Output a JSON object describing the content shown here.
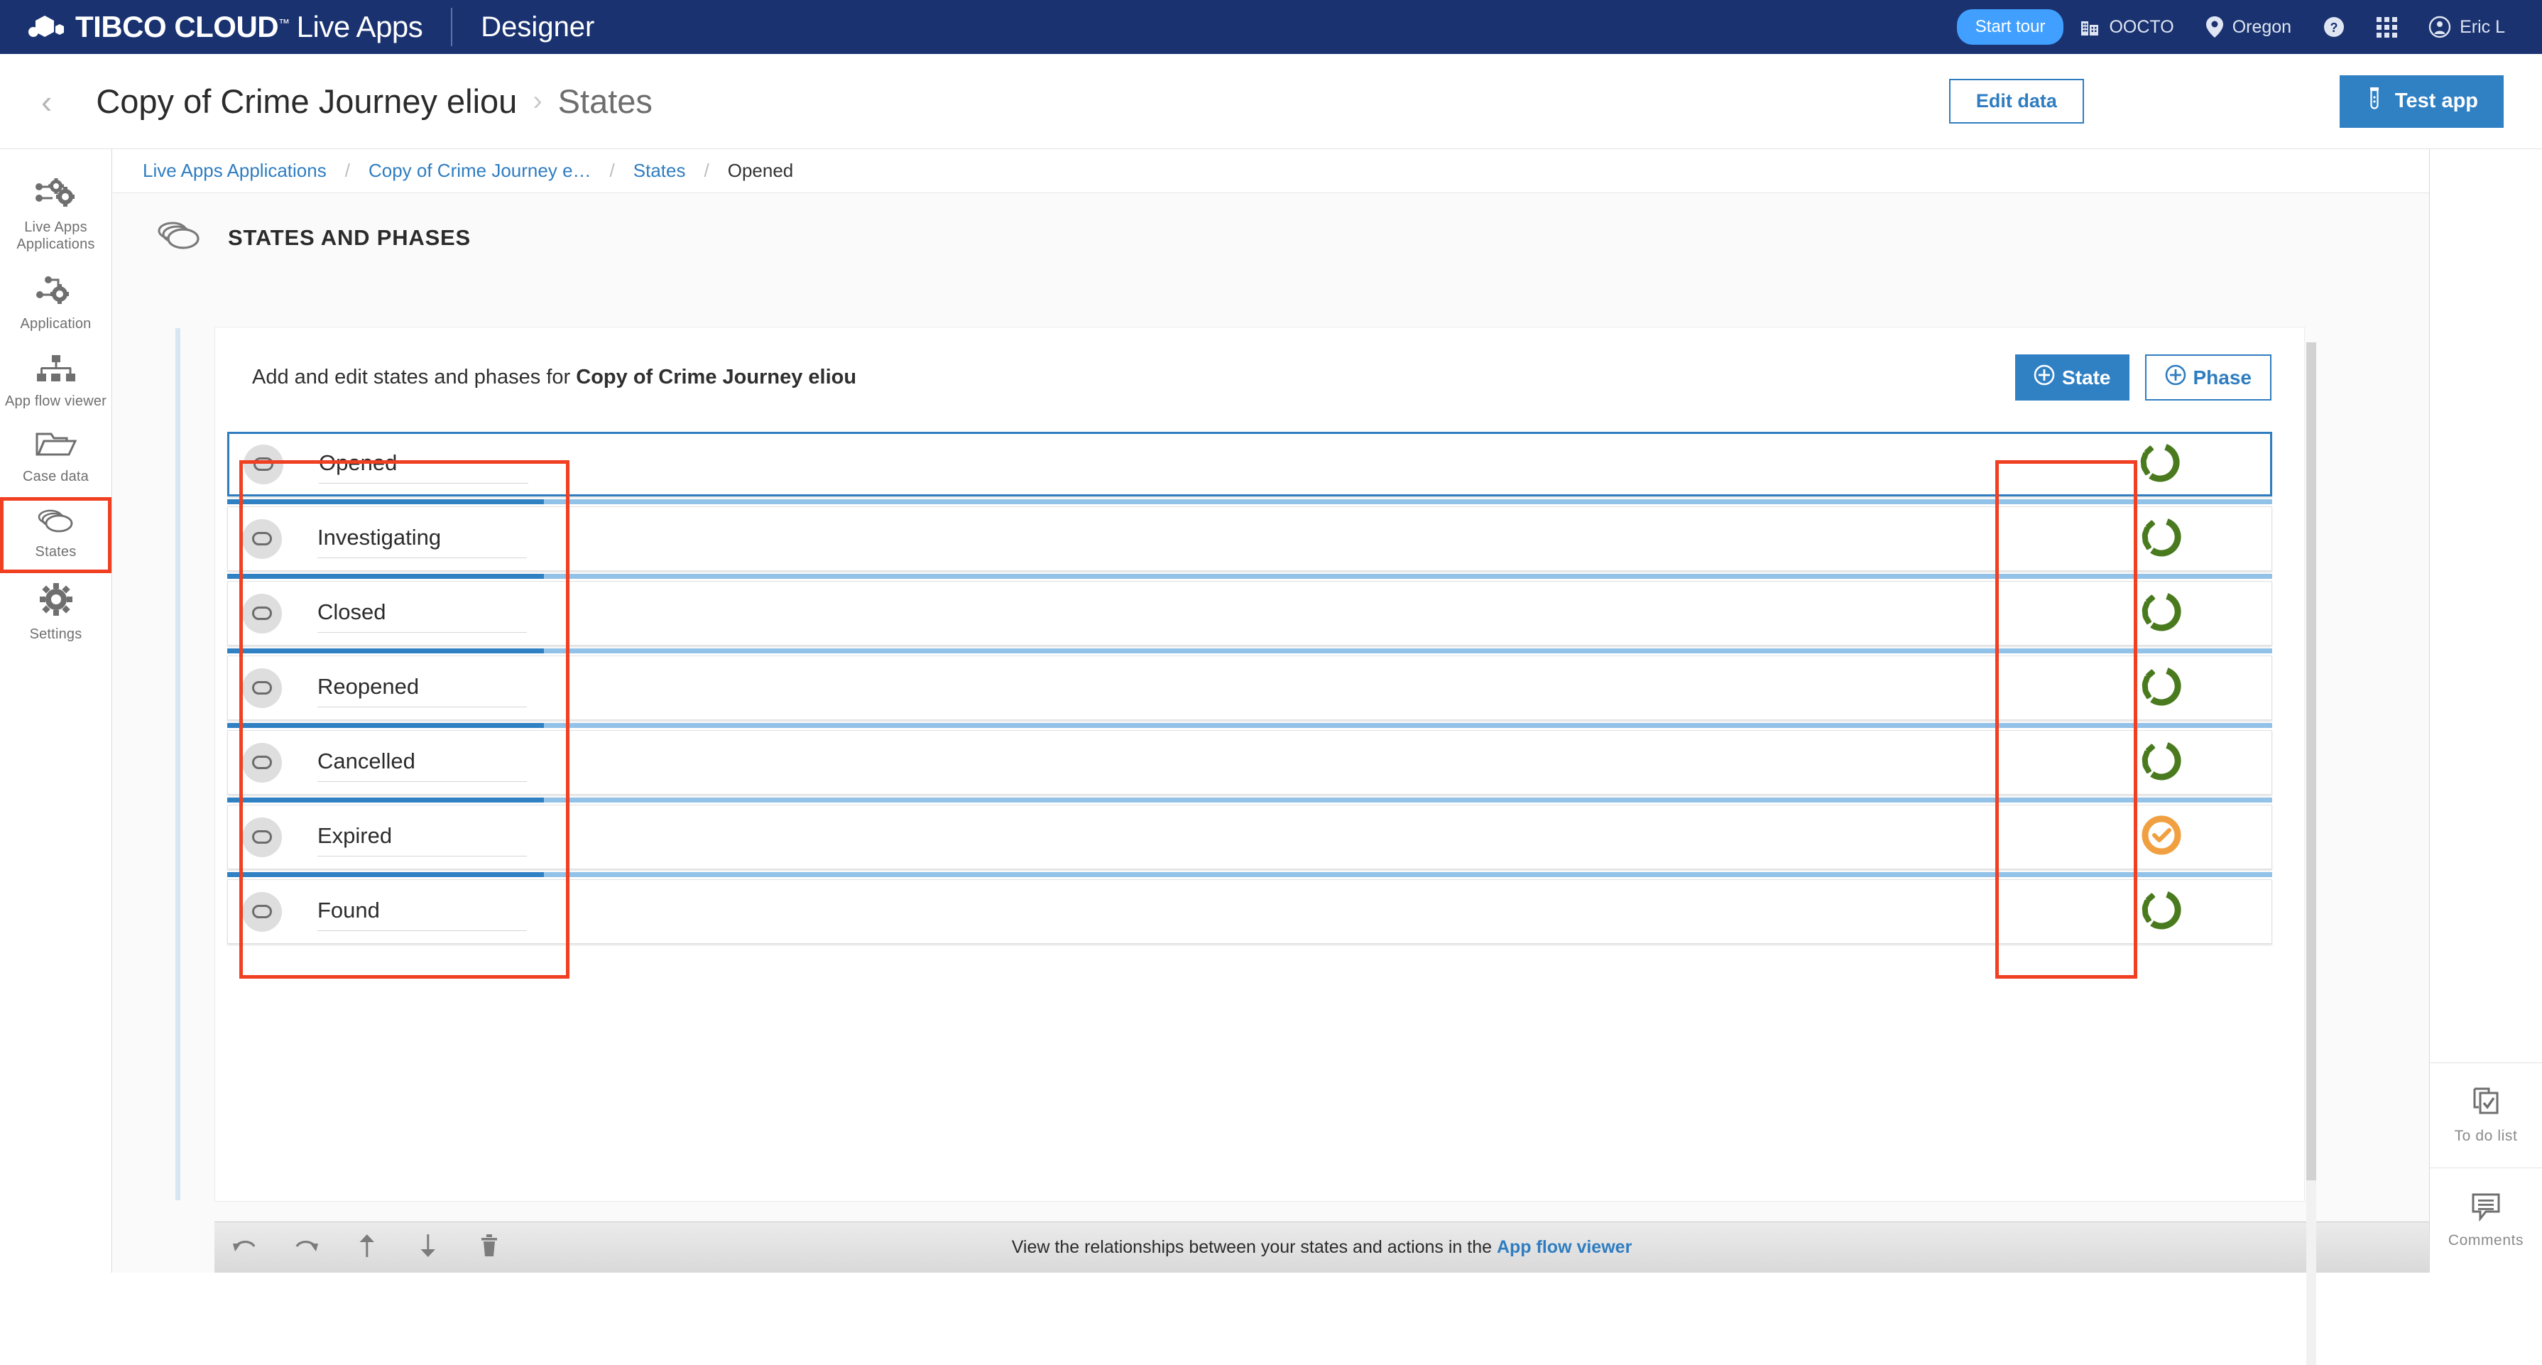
{
  "topnav": {
    "brand_bold": "TIBCO CLOUD",
    "brand_light": "Live Apps",
    "tm": "™",
    "product": "Designer",
    "start_tour": "Start tour",
    "org": "OOCTO",
    "region": "Oregon",
    "user": "Eric L",
    "icons": {
      "building": "building-icon",
      "location": "location-pin-icon",
      "help": "help-circle-icon",
      "apps": "apps-grid-icon",
      "avatar": "user-avatar-icon"
    }
  },
  "titlebar": {
    "back": "‹",
    "app_name": "Copy of Crime Journey eliou",
    "separator": "›",
    "section": "States",
    "edit_data": "Edit data",
    "test_app": "Test app"
  },
  "sidebar": {
    "items": [
      {
        "label": "Live Apps Applications",
        "icon": "live-apps-applications-icon",
        "active": false
      },
      {
        "label": "Application",
        "icon": "application-icon",
        "active": false
      },
      {
        "label": "App flow viewer",
        "icon": "app-flow-viewer-icon",
        "active": false
      },
      {
        "label": "Case data",
        "icon": "case-data-folder-icon",
        "active": false
      },
      {
        "label": "States",
        "icon": "states-stack-icon",
        "active": true
      },
      {
        "label": "Settings",
        "icon": "settings-gear-icon",
        "active": false
      }
    ]
  },
  "breadcrumb": {
    "items": [
      "Live Apps Applications",
      "Copy of Crime Journey e…",
      "States"
    ],
    "current": "Opened",
    "separator": "/"
  },
  "section": {
    "title": "STATES AND PHASES",
    "icon": "states-stack-icon"
  },
  "panel": {
    "desc_prefix": "Add and edit states and phases for ",
    "desc_app": "Copy of Crime Journey eliou",
    "add_state": "State",
    "add_phase": "Phase",
    "plus_icon": "plus-circle-icon"
  },
  "states": [
    {
      "name": "Opened",
      "selected": true,
      "status_icon": "in-progress-icon",
      "status": "in-progress"
    },
    {
      "name": "Investigating",
      "selected": false,
      "status_icon": "in-progress-icon",
      "status": "in-progress"
    },
    {
      "name": "Closed",
      "selected": false,
      "status_icon": "in-progress-icon",
      "status": "in-progress"
    },
    {
      "name": "Reopened",
      "selected": false,
      "status_icon": "in-progress-icon",
      "status": "in-progress"
    },
    {
      "name": "Cancelled",
      "selected": false,
      "status_icon": "in-progress-icon",
      "status": "in-progress"
    },
    {
      "name": "Expired",
      "selected": false,
      "status_icon": "terminal-check-icon",
      "status": "terminal"
    },
    {
      "name": "Found",
      "selected": false,
      "status_icon": "in-progress-icon",
      "status": "in-progress"
    }
  ],
  "bottombar": {
    "tools": [
      {
        "name": "undo-icon",
        "label": "Undo"
      },
      {
        "name": "redo-icon",
        "label": "Redo"
      },
      {
        "name": "move-up-icon",
        "label": "Move up"
      },
      {
        "name": "move-down-icon",
        "label": "Move down"
      },
      {
        "name": "delete-trash-icon",
        "label": "Delete"
      }
    ],
    "hint_prefix": "View the relationships between your states and actions in the ",
    "hint_link": "App flow viewer"
  },
  "rightrail": {
    "items": [
      {
        "label": "To do list",
        "icon": "todo-list-icon"
      },
      {
        "label": "Comments",
        "icon": "comments-icon"
      }
    ]
  },
  "colors": {
    "nav_bg": "#1a3370",
    "accent_blue": "#3080c4",
    "link_blue": "#2f7dc0",
    "start_tour": "#41a0ff",
    "annotation_red": "#f03f21",
    "status_green": "#4a7a1e",
    "status_orange": "#f0a040",
    "phase_dark": "#3080c4",
    "phase_light": "#92c2e8"
  }
}
